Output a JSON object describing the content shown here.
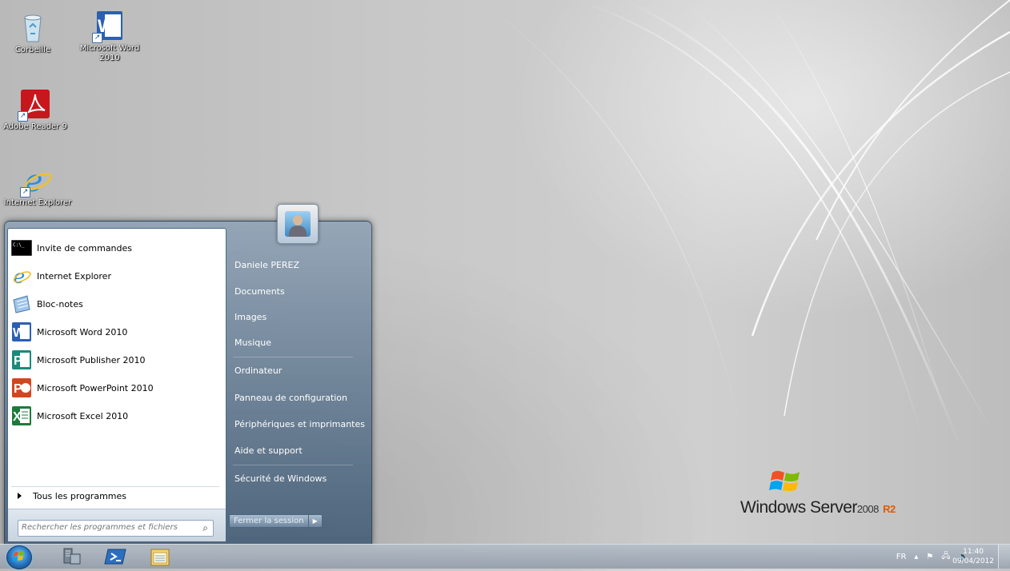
{
  "desktop": {
    "icons": [
      {
        "label": "Corbeille",
        "icon": "recycle-bin-icon"
      },
      {
        "label": "Microsoft Word 2010",
        "icon": "word-icon"
      },
      {
        "label": "Adobe Reader 9",
        "icon": "adobe-reader-icon"
      },
      {
        "label": "Internet Explorer",
        "icon": "internet-explorer-icon"
      }
    ]
  },
  "start_menu": {
    "programs": [
      {
        "label": "Invite de commandes",
        "icon": "cmd-icon"
      },
      {
        "label": "Internet Explorer",
        "icon": "internet-explorer-icon"
      },
      {
        "label": "Bloc-notes",
        "icon": "notepad-icon"
      },
      {
        "label": "Microsoft Word 2010",
        "icon": "word-icon"
      },
      {
        "label": "Microsoft Publisher 2010",
        "icon": "publisher-icon"
      },
      {
        "label": "Microsoft PowerPoint 2010",
        "icon": "powerpoint-icon"
      },
      {
        "label": "Microsoft Excel 2010",
        "icon": "excel-icon"
      }
    ],
    "all_programs": "Tous les programmes",
    "search_placeholder": "Rechercher les programmes et fichiers",
    "places": [
      "Daniele PEREZ",
      "Documents",
      "Images",
      "Musique",
      "Ordinateur",
      "Panneau de configuration",
      "Périphériques et imprimantes",
      "Aide et support",
      "Sécurité de Windows"
    ],
    "shutdown_label": "Fermer la session"
  },
  "branding": {
    "name": "Windows Server",
    "version": "2008",
    "edition": "R2"
  },
  "taskbar": {
    "language": "FR",
    "time": "11:40",
    "date": "09/04/2012",
    "pinned": [
      "server-manager-icon",
      "powershell-icon",
      "explorer-icon"
    ]
  }
}
